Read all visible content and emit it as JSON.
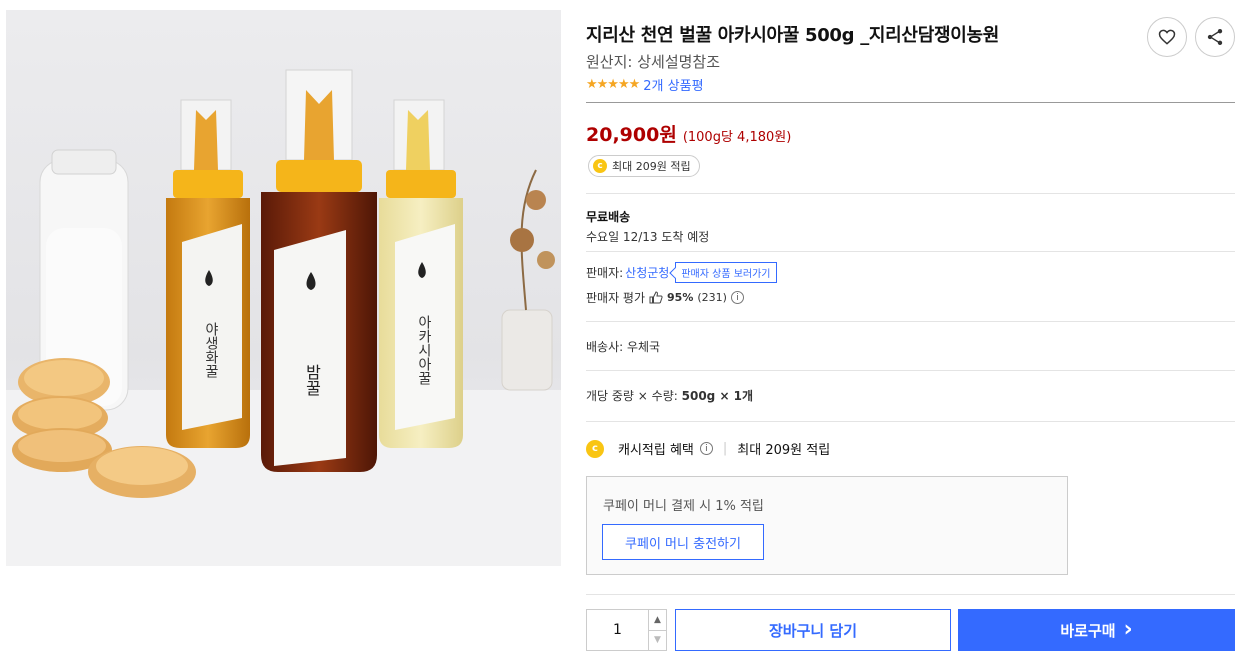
{
  "product": {
    "title": "지리산 천연 벌꿀 아카시아꿀 500g _지리산담쟁이농원",
    "origin": "원산지: 상세설명참조",
    "stars": "★★★★★",
    "review_link": "2개 상품평",
    "image_alt": "honey bottles photo",
    "bottle_labels": [
      "야생화꿀",
      "밤꿀",
      "아카시아꿀"
    ]
  },
  "actions": {
    "wishlist_icon": "heart-icon",
    "share_icon": "share-icon"
  },
  "price": {
    "amount": "20,900원",
    "unit": "(100g당 4,180원)",
    "cash_badge": "최대 209원 적립",
    "coin_symbol": "c"
  },
  "shipping": {
    "title": "무료배송",
    "date": "수요일 12/13 도착 예정"
  },
  "seller": {
    "label": "판매자:",
    "name": "산청군청",
    "more": "판매자 상품 보러가기",
    "eval_label": "판매자 평가",
    "eval_pct": "95%",
    "eval_count": "(231)"
  },
  "courier": "배송사: 우체국",
  "weight": {
    "label": "개당 중량 × 수량:",
    "value": "500g × 1개"
  },
  "cash_benefit": {
    "label": "캐시적립 혜택",
    "value": "최대 209원 적립"
  },
  "coupay": {
    "text": "쿠페이 머니 결제 시 1% 적립",
    "button": "쿠페이 머니 충전하기"
  },
  "purchase": {
    "quantity": "1",
    "cart": "장바구니 담기",
    "buy": "바로구매",
    "buy_arrow": "›"
  },
  "colors": {
    "accent": "#346aff",
    "price": "#ae0000",
    "star": "#f5a623",
    "coin": "#f9c513"
  }
}
